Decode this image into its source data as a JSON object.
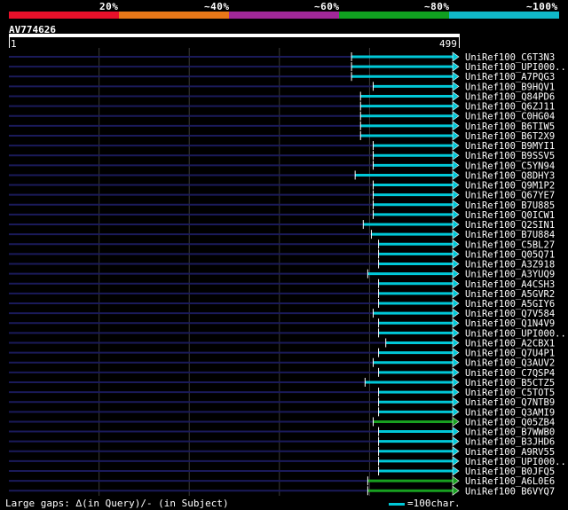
{
  "legend": {
    "items": [
      {
        "label": "20%",
        "color": "#e8102a"
      },
      {
        "label": "~40%",
        "color": "#e87818"
      },
      {
        "label": "~60%",
        "color": "#a02898"
      },
      {
        "label": "~80%",
        "color": "#10a020"
      },
      {
        "label": "~100%",
        "color": "#10b8c8"
      }
    ]
  },
  "query": {
    "name": "AV774626",
    "start": "1",
    "end": "499",
    "length": 499
  },
  "hits": [
    {
      "id": "UniRef100_C6T3N3",
      "start": 380,
      "color": "#00c8d8"
    },
    {
      "id": "UniRef100_UPI000..",
      "start": 380,
      "color": "#00c8d8"
    },
    {
      "id": "UniRef100_A7PQG3",
      "start": 380,
      "color": "#00c8d8"
    },
    {
      "id": "UniRef100_B9HQV1",
      "start": 404,
      "color": "#00c8d8"
    },
    {
      "id": "UniRef100_Q84PD6",
      "start": 390,
      "color": "#00c8d8"
    },
    {
      "id": "UniRef100_Q6ZJ11",
      "start": 390,
      "color": "#00c8d8"
    },
    {
      "id": "UniRef100_C0HG04",
      "start": 390,
      "color": "#00c8d8"
    },
    {
      "id": "UniRef100_B6TIW5",
      "start": 390,
      "color": "#00c8d8"
    },
    {
      "id": "UniRef100_B6T2X9",
      "start": 390,
      "color": "#00c8d8"
    },
    {
      "id": "UniRef100_B9MYI1",
      "start": 404,
      "color": "#00c8d8"
    },
    {
      "id": "UniRef100_B9SSV5",
      "start": 404,
      "color": "#00c8d8"
    },
    {
      "id": "UniRef100_C5YN94",
      "start": 404,
      "color": "#00c8d8"
    },
    {
      "id": "UniRef100_Q8DHY3",
      "start": 384,
      "color": "#00c8d8"
    },
    {
      "id": "UniRef100_Q9M1P2",
      "start": 404,
      "color": "#00c8d8"
    },
    {
      "id": "UniRef100_Q67YE7",
      "start": 404,
      "color": "#00c8d8"
    },
    {
      "id": "UniRef100_B7U885",
      "start": 404,
      "color": "#00c8d8"
    },
    {
      "id": "UniRef100_Q0ICW1",
      "start": 404,
      "color": "#00c8d8"
    },
    {
      "id": "UniRef100_Q2SIN1",
      "start": 393,
      "color": "#00c8d8"
    },
    {
      "id": "UniRef100_B7U884",
      "start": 402,
      "color": "#00c8d8"
    },
    {
      "id": "UniRef100_C5BL27",
      "start": 410,
      "color": "#00c8d8"
    },
    {
      "id": "UniRef100_Q05Q71",
      "start": 410,
      "color": "#00c8d8"
    },
    {
      "id": "UniRef100_A3Z918",
      "start": 410,
      "color": "#00c8d8"
    },
    {
      "id": "UniRef100_A3YUQ9",
      "start": 398,
      "color": "#00c8d8"
    },
    {
      "id": "UniRef100_A4CSH3",
      "start": 410,
      "color": "#00c8d8"
    },
    {
      "id": "UniRef100_A5GVR2",
      "start": 410,
      "color": "#00c8d8"
    },
    {
      "id": "UniRef100_A5GIY6",
      "start": 410,
      "color": "#00c8d8"
    },
    {
      "id": "UniRef100_Q7V584",
      "start": 404,
      "color": "#00c8d8"
    },
    {
      "id": "UniRef100_Q1N4V9",
      "start": 410,
      "color": "#00c8d8"
    },
    {
      "id": "UniRef100_UPI000..",
      "start": 410,
      "color": "#00c8d8"
    },
    {
      "id": "UniRef100_A2CBX1",
      "start": 418,
      "color": "#00c8d8"
    },
    {
      "id": "UniRef100_Q7U4P1",
      "start": 410,
      "color": "#00c8d8"
    },
    {
      "id": "UniRef100_Q3AUV2",
      "start": 404,
      "color": "#00c8d8"
    },
    {
      "id": "UniRef100_C7QSP4",
      "start": 410,
      "color": "#00c8d8"
    },
    {
      "id": "UniRef100_B5CTZ5",
      "start": 395,
      "color": "#00c8d8"
    },
    {
      "id": "UniRef100_C5TOT5",
      "start": 410,
      "color": "#00c8d8"
    },
    {
      "id": "UniRef100_Q7NTB9",
      "start": 410,
      "color": "#00c8d8"
    },
    {
      "id": "UniRef100_Q3AMI9",
      "start": 410,
      "color": "#00c8d8"
    },
    {
      "id": "UniRef100_Q05ZB4",
      "start": 404,
      "color": "#18a020"
    },
    {
      "id": "UniRef100_B7WWB0",
      "start": 410,
      "color": "#00c8d8"
    },
    {
      "id": "UniRef100_B3JHD6",
      "start": 410,
      "color": "#00c8d8"
    },
    {
      "id": "UniRef100_A9RV55",
      "start": 410,
      "color": "#00c8d8"
    },
    {
      "id": "UniRef100_UPI000..",
      "start": 410,
      "color": "#00c8d8"
    },
    {
      "id": "UniRef100_B0JFQ5",
      "start": 410,
      "color": "#00c8d8"
    },
    {
      "id": "UniRef100_A6L0E6",
      "start": 398,
      "color": "#18a020"
    },
    {
      "id": "UniRef100_B6VYQ7",
      "start": 398,
      "color": "#18a020"
    }
  ],
  "footer": {
    "gaps_text": "Large gaps: ∆(in Query)/‐ (in Subject)",
    "scale_text": "=100char."
  }
}
